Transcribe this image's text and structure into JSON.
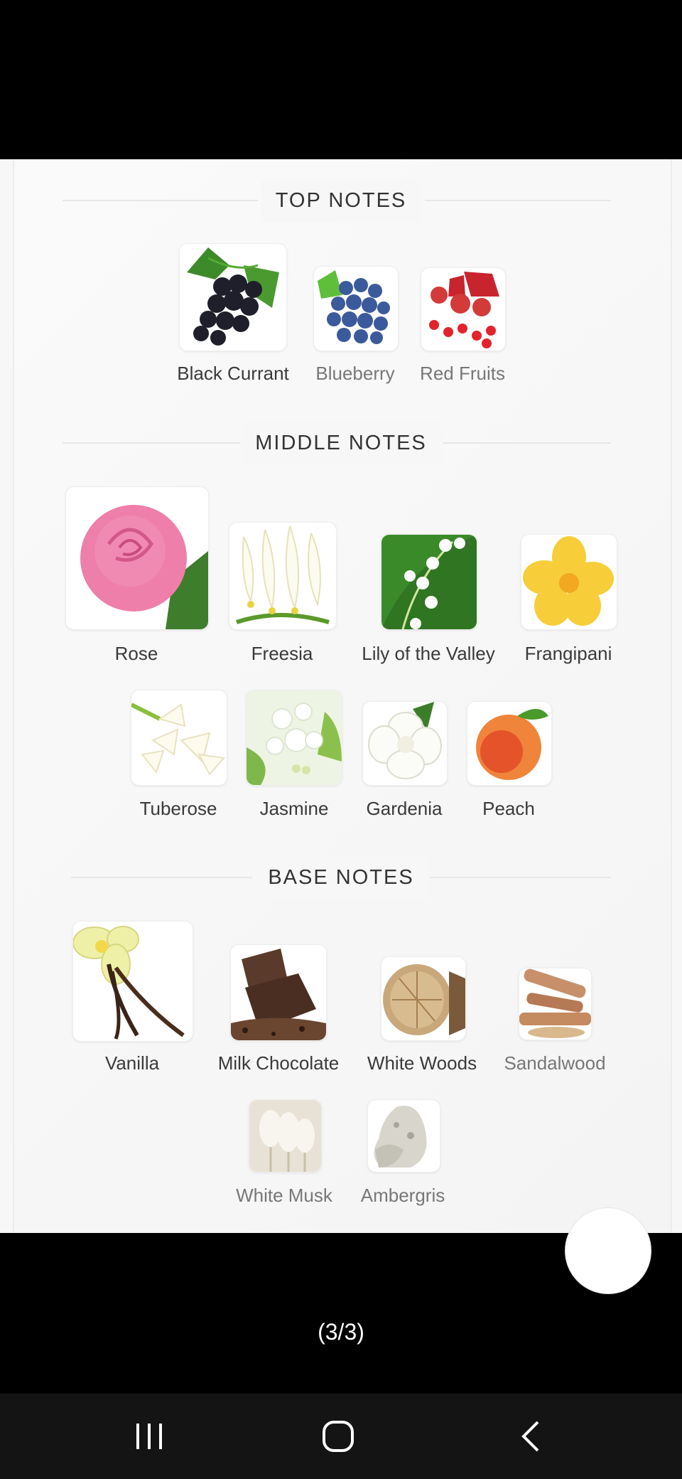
{
  "sections": {
    "top": {
      "title": "TOP NOTES",
      "notes": [
        "Black Currant",
        "Blueberry",
        "Red Fruits"
      ]
    },
    "middle": {
      "title": "MIDDLE NOTES",
      "notes": [
        "Rose",
        "Freesia",
        "Lily of the Valley",
        "Frangipani",
        "Tuberose",
        "Jasmine",
        "Gardenia",
        "Peach"
      ]
    },
    "base": {
      "title": "BASE NOTES",
      "notes": [
        "Vanilla",
        "Milk Chocolate",
        "White Woods",
        "Sandalwood",
        "White Musk",
        "Ambergris"
      ]
    }
  },
  "pager": {
    "label": "(3/3)"
  },
  "icons": {
    "recents": "recents-icon",
    "home": "home-icon",
    "back": "back-icon"
  }
}
